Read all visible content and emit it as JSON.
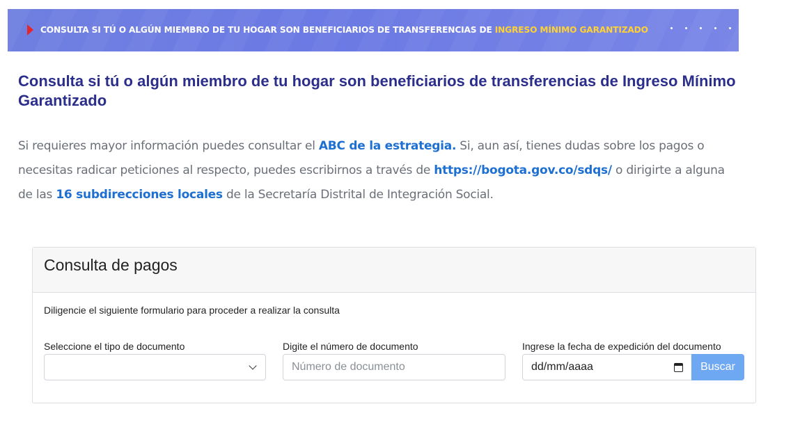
{
  "banner": {
    "text_main": "CONSULTA SI TÚ O ALGÚN MIEMBRO DE TU HOGAR SON BENEFICIARIOS DE TRANSFERENCIAS DE ",
    "text_highlight": "INGRESO MÍNIMO GARANTIZADO",
    "colors": {
      "background": "#6f7fe0",
      "highlight": "#ffd233",
      "arrow": "#e3262b"
    }
  },
  "page": {
    "title": "Consulta si tú o algún miembro de tu hogar son beneficiarios de transferencias de Ingreso Mínimo Garantizado"
  },
  "intro": {
    "part1": "Si requieres mayor información puedes consultar el ",
    "link_abc": "ABC de la estrategia.",
    "part2": " Si, aun así, tienes dudas sobre los pagos o necesitas radicar peticiones al respecto, puedes escribirnos a través de ",
    "link_sdqs": "https://bogota.gov.co/sdqs/",
    "part3": " o dirigirte a alguna de las ",
    "link_subdirecciones": "16 subdirecciones locales",
    "part4": " de la Secretaría Distrital de Integración Social.",
    "link_color": "#1d6fd1"
  },
  "form": {
    "title": "Consulta de pagos",
    "description": "Diligencie el siguiente formulario para proceder a realizar la consulta",
    "doc_type": {
      "label": "Seleccione el tipo de documento",
      "value": ""
    },
    "doc_number": {
      "label": "Digite el número de documento",
      "placeholder": "Número de documento"
    },
    "issue_date": {
      "label": "Ingrese la fecha de expedición del documento",
      "placeholder": "dd/mm/aaaa"
    },
    "submit_label": "Buscar",
    "submit_color": "#6fa8f2"
  }
}
